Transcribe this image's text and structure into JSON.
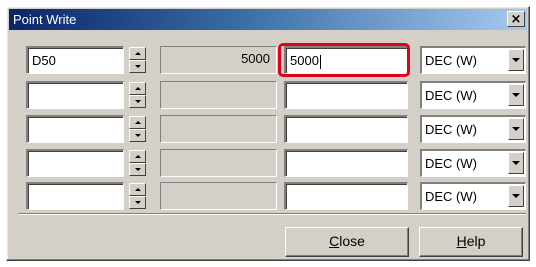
{
  "window": {
    "title": "Point Write",
    "close_glyph": "×"
  },
  "rows": [
    {
      "device": "D50",
      "current": "5000",
      "value": "5000",
      "format": "DEC (W)"
    },
    {
      "device": "",
      "current": "",
      "value": "",
      "format": "DEC (W)"
    },
    {
      "device": "",
      "current": "",
      "value": "",
      "format": "DEC (W)"
    },
    {
      "device": "",
      "current": "",
      "value": "",
      "format": "DEC (W)"
    },
    {
      "device": "",
      "current": "",
      "value": "",
      "format": "DEC (W)"
    }
  ],
  "buttons": {
    "close_mnemonic": "C",
    "close_rest": "lose",
    "help_mnemonic": "H",
    "help_rest": "elp"
  },
  "colors": {
    "highlight": "#e0001b",
    "dialog_face": "#d4d0c8",
    "title_start": "#0a246a"
  },
  "icons": {
    "spin": [
      "spin-up-icon",
      "spin-down-icon"
    ],
    "dropdown": "chevron-down-icon",
    "close": "close-icon"
  }
}
